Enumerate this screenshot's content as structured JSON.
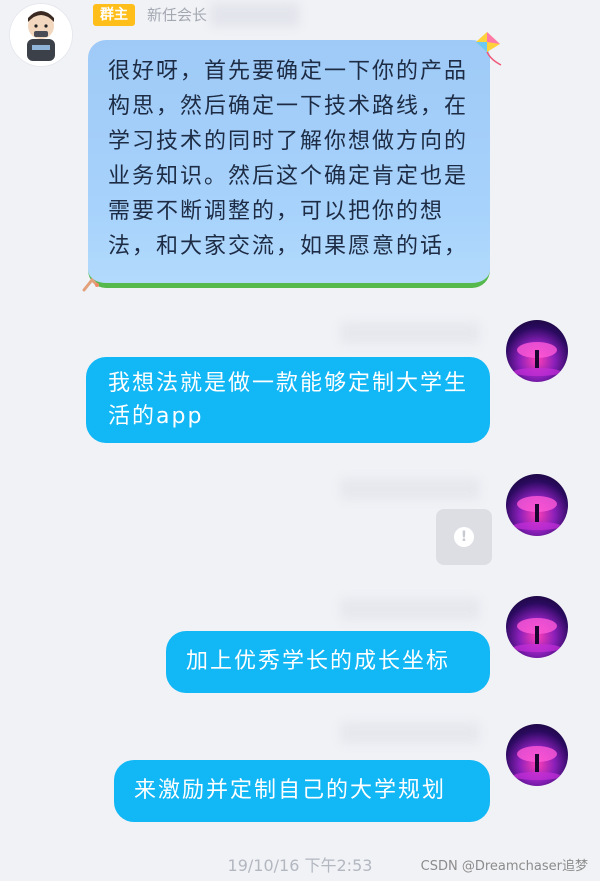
{
  "incoming": {
    "role_badge": "群主",
    "sender_name": "新任会长",
    "message": "很好呀，首先要确定一下你的产品构思，然后确定一下技术路线，在学习技术的同时了解你想做方向的业务知识。然后这个确定肯定也是需要不断调整的，可以把你的想法，和大家交流，如果愿意的话，"
  },
  "outgoing": [
    {
      "text": "我想法就是做一款能够定制大学生活的app"
    },
    {
      "text": ""
    },
    {
      "text": "加上优秀学长的成长坐标"
    },
    {
      "text": "来激励并定制自己的大学规划"
    }
  ],
  "loading_icon": "alert-icon",
  "timestamp": "19/10/16 下午2:53",
  "watermark": "CSDN @Dreamchaser追梦",
  "colors": {
    "page_bg": "#f1f2f6",
    "outgoing_bubble": "#12b7f5",
    "incoming_bubble": "#a7d2fb",
    "role_badge": "#ffbe1a"
  }
}
